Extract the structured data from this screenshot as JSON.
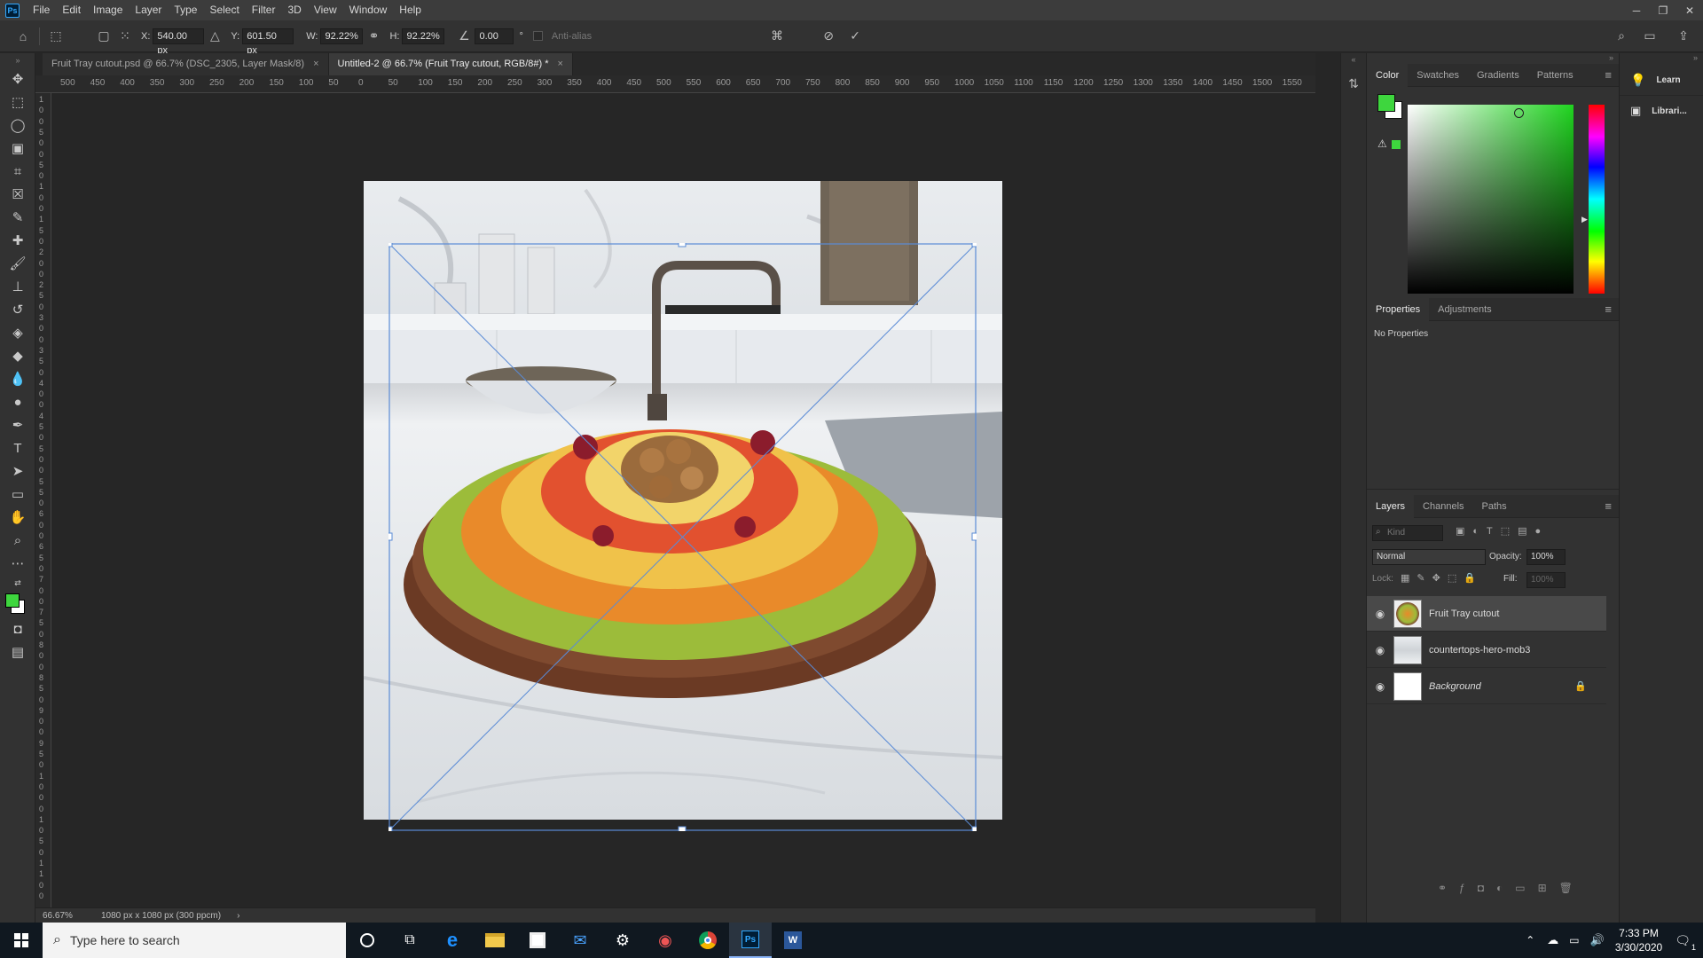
{
  "app": {
    "logo": "Ps"
  },
  "menu": [
    "File",
    "Edit",
    "Image",
    "Layer",
    "Type",
    "Select",
    "Filter",
    "3D",
    "View",
    "Window",
    "Help"
  ],
  "window_controls": {
    "minimize": "─",
    "restore": "❐",
    "close": "✕"
  },
  "options": {
    "x_label": "X:",
    "x_value": "540.00 px",
    "y_label": "Y:",
    "y_value": "601.50 px",
    "w_label": "W:",
    "w_value": "92.22%",
    "h_label": "H:",
    "h_value": "92.22%",
    "angle_value": "0.00",
    "angle_unit": "°",
    "antialias_label": "Anti-alias"
  },
  "tabs": [
    {
      "label": "Fruit Tray cutout.psd @ 66.7% (DSC_2305, Layer Mask/8)",
      "close": "×"
    },
    {
      "label": "Untitled-2 @ 66.7% (Fruit Tray cutout, RGB/8#) *",
      "close": "×"
    }
  ],
  "ruler_h": [
    "500",
    "450",
    "400",
    "350",
    "300",
    "250",
    "200",
    "150",
    "100",
    "50",
    "0",
    "50",
    "100",
    "150",
    "200",
    "250",
    "300",
    "350",
    "400",
    "450",
    "500",
    "550",
    "600",
    "650",
    "700",
    "750",
    "800",
    "850",
    "900",
    "950",
    "1000",
    "1050",
    "1100",
    "1150",
    "1200",
    "1250",
    "1300",
    "1350",
    "1400",
    "1450",
    "1500",
    "1550"
  ],
  "ruler_v": [
    "1",
    "0",
    "0",
    "5",
    "0",
    "0",
    "5",
    "0",
    "1",
    "0",
    "0",
    "1",
    "5",
    "0",
    "2",
    "0",
    "0",
    "2",
    "5",
    "0",
    "3",
    "0",
    "0",
    "3",
    "5",
    "0",
    "4",
    "0",
    "0",
    "4",
    "5",
    "0",
    "5",
    "0",
    "0",
    "5",
    "5",
    "0",
    "6",
    "0",
    "0",
    "6",
    "5",
    "0",
    "7",
    "0",
    "0",
    "7",
    "5",
    "0",
    "8",
    "0",
    "0",
    "8",
    "5",
    "0",
    "9",
    "0",
    "0",
    "9",
    "5",
    "0",
    "1",
    "0",
    "0",
    "0",
    "1",
    "0",
    "5",
    "0",
    "1",
    "1",
    "0",
    "0"
  ],
  "status": {
    "zoom": "66.67%",
    "doc_info": "1080 px x 1080 px (300 ppcm)",
    "arrow": "›"
  },
  "color_panel": {
    "tabs": [
      "Color",
      "Swatches",
      "Gradients",
      "Patterns"
    ],
    "fg_color": "#3ed63e",
    "hue_color": "#1fd41f"
  },
  "properties_panel": {
    "tabs": [
      "Properties",
      "Adjustments"
    ],
    "body": "No Properties"
  },
  "layers_panel": {
    "tabs": [
      "Layers",
      "Channels",
      "Paths"
    ],
    "filter_placeholder": "Kind",
    "blend_mode": "Normal",
    "opacity_label": "Opacity:",
    "opacity_value": "100%",
    "lock_label": "Lock:",
    "fill_label": "Fill:",
    "fill_value": "100%",
    "layers": [
      {
        "name": "Fruit Tray cutout",
        "selected": true
      },
      {
        "name": "countertops-hero-mob3",
        "selected": false
      },
      {
        "name": "Background",
        "selected": false,
        "locked": true
      }
    ]
  },
  "right_dock": {
    "learn": "Learn",
    "libraries": "Librari..."
  },
  "taskbar": {
    "search_placeholder": "Type here to search",
    "time": "7:33 PM",
    "date": "3/30/2020",
    "notification_count": "1"
  }
}
